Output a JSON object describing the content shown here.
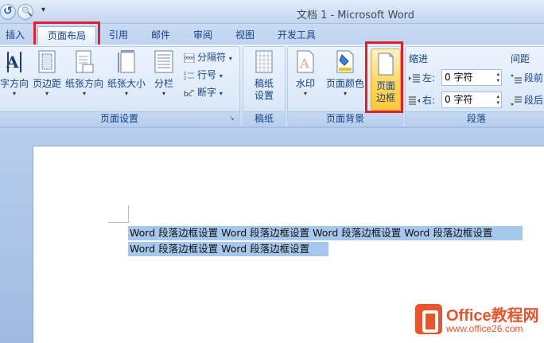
{
  "titlebar": {
    "title": "文档 1 - Microsoft Word",
    "customize_glyph": "▾",
    "undo_icon": "undo-icon",
    "preview_icon": "print-preview-icon"
  },
  "tabs": [
    {
      "label": "插入"
    },
    {
      "label": "页面布局",
      "active": true
    },
    {
      "label": "引用"
    },
    {
      "label": "邮件"
    },
    {
      "label": "审阅"
    },
    {
      "label": "视图"
    },
    {
      "label": "开发工具"
    }
  ],
  "groups": {
    "page_setup": {
      "label": "页面设置",
      "text_direction": "字方向",
      "margins": "页边距",
      "orientation": "纸张方向",
      "size": "纸张大小",
      "columns": "分栏",
      "breaks": "分隔符",
      "line_numbers": "行号",
      "hyphenation": "断字"
    },
    "draft_paper": {
      "label": "稿纸",
      "settings_line1": "稿纸",
      "settings_line2": "设置"
    },
    "page_background": {
      "label": "页面背景",
      "watermark": "水印",
      "page_color": "页面颜色",
      "page_border_line1": "页面",
      "page_border_line2": "边框"
    },
    "paragraph": {
      "label": "段落",
      "indent_title": "缩进",
      "spacing_title": "间距",
      "left_label": "左:",
      "right_label": "右:",
      "left_value": "0 字符",
      "right_value": "0 字符",
      "before_label": "段前",
      "after_label": "段后"
    }
  },
  "document": {
    "line1": "Word 段落边框设置 Word 段落边框设置 Word 段落边框设置 Word 段落边框设置",
    "line2": "Word 段落边框设置 Word 段落边框设置"
  },
  "watermark": {
    "title": "Office教程网",
    "url": "www.office26.com"
  },
  "colors": {
    "highlight_box": "#e0202c",
    "selection": "#a6c8ec",
    "ribbon_text": "#15428b",
    "logo_orange": "#e8542e"
  }
}
